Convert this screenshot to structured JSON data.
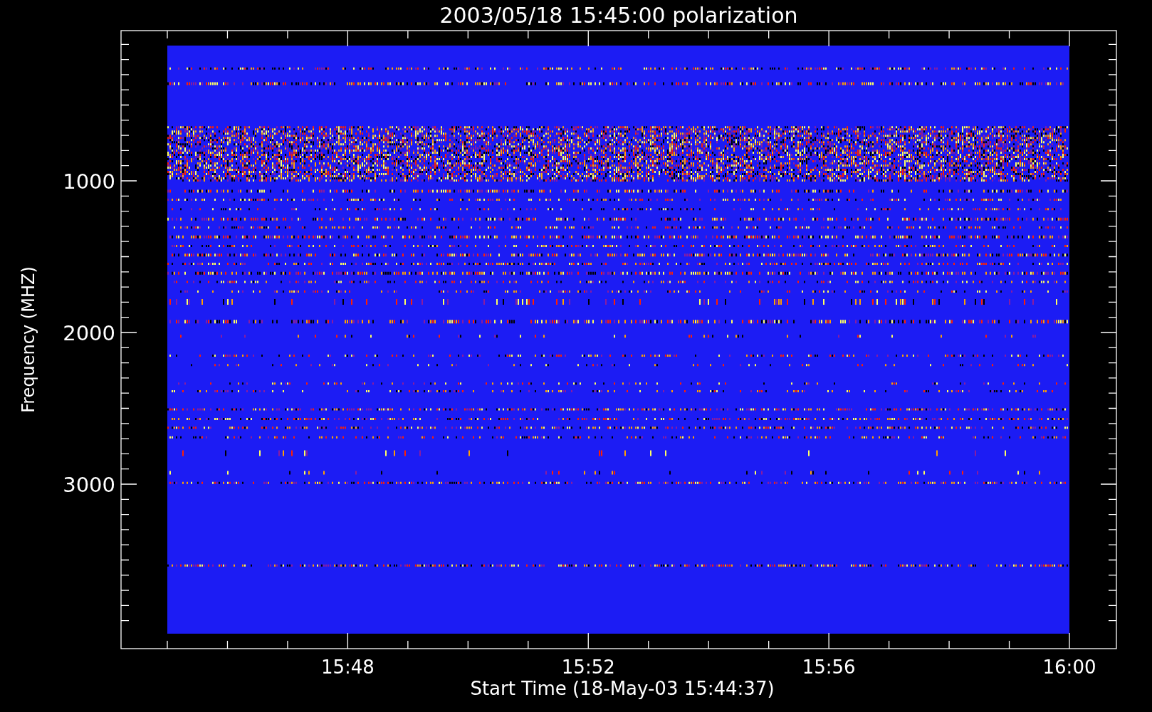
{
  "title": "2003/05/18 15:45:00 polarization",
  "y_axis": {
    "label": "Frequency (MHZ)",
    "ticks": [
      "1000",
      "2000",
      "3000"
    ]
  },
  "x_axis": {
    "label": "Start Time (18-May-03 15:44:37)",
    "ticks": [
      "15:48",
      "15:52",
      "15:56",
      "16:00"
    ]
  }
}
